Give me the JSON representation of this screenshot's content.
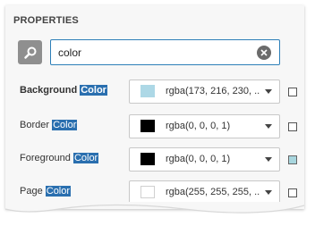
{
  "panel": {
    "title": "PROPERTIES"
  },
  "search": {
    "value": "color",
    "button_icon": "magnifier-icon",
    "clear_icon": "clear-circle-icon"
  },
  "properties": [
    {
      "label_prefix": "Background ",
      "label_match": "Color",
      "label_bold": true,
      "value": "rgba(173, 216, 230, ...",
      "swatch_color": "#add8e6",
      "marker_set": false
    },
    {
      "label_prefix": "Border ",
      "label_match": "Color",
      "label_bold": false,
      "value": "rgba(0, 0, 0, 1)",
      "swatch_color": "#000000",
      "marker_set": false
    },
    {
      "label_prefix": "Foreground ",
      "label_match": "Color",
      "label_bold": false,
      "value": "rgba(0, 0, 0, 1)",
      "swatch_color": "#000000",
      "marker_set": true
    },
    {
      "label_prefix": "Page ",
      "label_match": "Color",
      "label_bold": false,
      "value": "rgba(255, 255, 255, ...",
      "swatch_color": "#ffffff",
      "marker_set": false
    }
  ],
  "colors": {
    "accent": "#2a6faf",
    "focus_border": "#2d7fb8",
    "panel_bg": "#f7f7f7"
  }
}
